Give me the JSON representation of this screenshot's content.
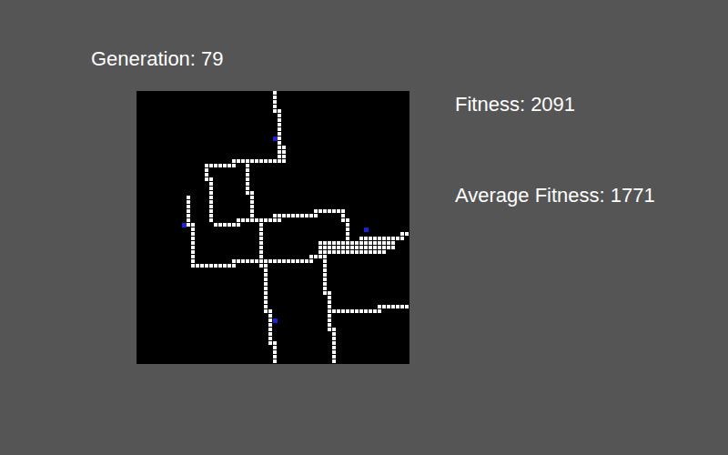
{
  "generation_label": "Generation: 79",
  "fitness_label": "Fitness: 2091",
  "average_fitness_label": "Average Fitness: 1771",
  "grid": {
    "size": 60,
    "path_segments": [
      [
        [
          30,
          0
        ],
        [
          30,
          4
        ]
      ],
      [
        [
          31,
          4
        ],
        [
          31,
          14
        ]
      ],
      [
        [
          32,
          12
        ],
        [
          32,
          15
        ]
      ],
      [
        [
          21,
          15
        ],
        [
          32,
          15
        ]
      ],
      [
        [
          15,
          16
        ],
        [
          21,
          16
        ]
      ],
      [
        [
          15,
          16
        ],
        [
          15,
          19
        ]
      ],
      [
        [
          16,
          19
        ],
        [
          16,
          28
        ]
      ],
      [
        [
          17,
          29
        ],
        [
          22,
          29
        ]
      ],
      [
        [
          22,
          28
        ],
        [
          31,
          28
        ]
      ],
      [
        [
          24,
          16
        ],
        [
          24,
          22
        ]
      ],
      [
        [
          25,
          22
        ],
        [
          25,
          28
        ]
      ],
      [
        [
          11,
          23
        ],
        [
          11,
          29
        ]
      ],
      [
        [
          12,
          29
        ],
        [
          12,
          38
        ]
      ],
      [
        [
          13,
          38
        ],
        [
          21,
          38
        ]
      ],
      [
        [
          21,
          37
        ],
        [
          29,
          37
        ]
      ],
      [
        [
          27,
          28
        ],
        [
          27,
          38
        ]
      ],
      [
        [
          28,
          38
        ],
        [
          28,
          48
        ]
      ],
      [
        [
          29,
          48
        ],
        [
          29,
          55
        ]
      ],
      [
        [
          30,
          55
        ],
        [
          30,
          59
        ]
      ],
      [
        [
          29,
          37
        ],
        [
          38,
          37
        ]
      ],
      [
        [
          38,
          36
        ],
        [
          40,
          36
        ]
      ],
      [
        [
          40,
          35
        ],
        [
          44,
          35
        ]
      ],
      [
        [
          30,
          27
        ],
        [
          39,
          27
        ]
      ],
      [
        [
          39,
          26
        ],
        [
          45,
          26
        ]
      ],
      [
        [
          45,
          26
        ],
        [
          45,
          28
        ]
      ],
      [
        [
          46,
          28
        ],
        [
          46,
          33
        ]
      ],
      [
        [
          40,
          33
        ],
        [
          56,
          33
        ]
      ],
      [
        [
          40,
          34
        ],
        [
          56,
          34
        ]
      ],
      [
        [
          40,
          35
        ],
        [
          54,
          35
        ]
      ],
      [
        [
          49,
          32
        ],
        [
          58,
          32
        ]
      ],
      [
        [
          58,
          31
        ],
        [
          59,
          31
        ]
      ],
      [
        [
          41,
          33
        ],
        [
          41,
          44
        ]
      ],
      [
        [
          42,
          44
        ],
        [
          42,
          52
        ]
      ],
      [
        [
          43,
          52
        ],
        [
          43,
          59
        ]
      ],
      [
        [
          43,
          48
        ],
        [
          53,
          48
        ]
      ],
      [
        [
          53,
          47
        ],
        [
          59,
          47
        ]
      ]
    ],
    "nodes": [
      {
        "col": 30,
        "row": 10,
        "color": "#1f1fe0"
      },
      {
        "col": 10,
        "row": 29,
        "color": "#1f1fe0"
      },
      {
        "col": 50,
        "row": 30,
        "color": "#1f1fe0"
      },
      {
        "col": 30,
        "row": 50,
        "color": "#1f1fe0"
      }
    ]
  }
}
